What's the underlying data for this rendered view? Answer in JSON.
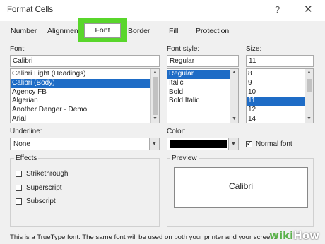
{
  "window": {
    "title": "Format Cells",
    "help_glyph": "?",
    "close_glyph": "✕"
  },
  "tabs": [
    {
      "label": "Number"
    },
    {
      "label": "Alignment"
    },
    {
      "label": "Font"
    },
    {
      "label": "Border"
    },
    {
      "label": "Fill"
    },
    {
      "label": "Protection"
    }
  ],
  "font": {
    "label": "Font:",
    "value": "Calibri",
    "items": [
      "Calibri Light (Headings)",
      "Calibri (Body)",
      "Agency FB",
      "Algerian",
      "Another Danger - Demo",
      "Arial"
    ],
    "selected_index": 1
  },
  "style": {
    "label": "Font style:",
    "value": "Regular",
    "items": [
      "Regular",
      "Italic",
      "Bold",
      "Bold Italic"
    ],
    "selected_index": 0
  },
  "size": {
    "label": "Size:",
    "value": "11",
    "items": [
      "8",
      "9",
      "10",
      "11",
      "12",
      "14"
    ],
    "selected_index": 3
  },
  "underline": {
    "label": "Underline:",
    "value": "None"
  },
  "color": {
    "label": "Color:",
    "swatch": "#000000",
    "normal_font_label": "Normal font",
    "normal_font_checked": true
  },
  "effects": {
    "legend": "Effects",
    "items": [
      {
        "label": "Strikethrough",
        "checked": false
      },
      {
        "label": "Superscript",
        "checked": false
      },
      {
        "label": "Subscript",
        "checked": false
      }
    ]
  },
  "preview": {
    "legend": "Preview",
    "sample": "Calibri"
  },
  "footer": {
    "text": "This is a TrueType font.  The same font will be used on both your printer and your screen."
  },
  "watermark": {
    "prefix": "wiki",
    "suffix": "How"
  },
  "colors": {
    "highlight": "#59d62b",
    "selection": "#1e6cc6"
  }
}
